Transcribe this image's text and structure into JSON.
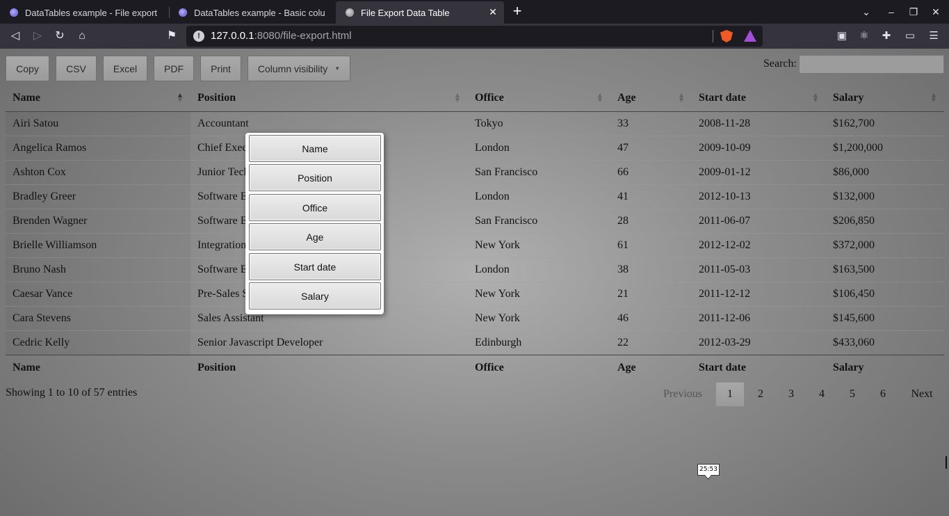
{
  "browser": {
    "tabs": [
      {
        "title": "DataTables example - File export",
        "active": false
      },
      {
        "title": "DataTables example - Basic colu",
        "active": false
      },
      {
        "title": "File Export Data Table",
        "active": true
      }
    ],
    "url_host": "127.0.0.1",
    "url_path": ":8080/file-export.html",
    "new_tab_glyph": "+",
    "close_glyph": "✕"
  },
  "toolbar": {
    "buttons": [
      "Copy",
      "CSV",
      "Excel",
      "PDF",
      "Print",
      "Column visibility"
    ],
    "search_label": "Search:",
    "search_value": ""
  },
  "table": {
    "columns": [
      "Name",
      "Position",
      "Office",
      "Age",
      "Start date",
      "Salary"
    ],
    "sorted_column": "Name",
    "sort_direction": "ascending",
    "rows": [
      [
        "Airi Satou",
        "Accountant",
        "Tokyo",
        "33",
        "2008-11-28",
        "$162,700"
      ],
      [
        "Angelica Ramos",
        "Chief Executive Officer (CEO)",
        "London",
        "47",
        "2009-10-09",
        "$1,200,000"
      ],
      [
        "Ashton Cox",
        "Junior Technical Author",
        "San Francisco",
        "66",
        "2009-01-12",
        "$86,000"
      ],
      [
        "Bradley Greer",
        "Software Engineer",
        "London",
        "41",
        "2012-10-13",
        "$132,000"
      ],
      [
        "Brenden Wagner",
        "Software Engineer",
        "San Francisco",
        "28",
        "2011-06-07",
        "$206,850"
      ],
      [
        "Brielle Williamson",
        "Integration Specialist",
        "New York",
        "61",
        "2012-12-02",
        "$372,000"
      ],
      [
        "Bruno Nash",
        "Software Engineer",
        "London",
        "38",
        "2011-05-03",
        "$163,500"
      ],
      [
        "Caesar Vance",
        "Pre-Sales Support",
        "New York",
        "21",
        "2011-12-12",
        "$106,450"
      ],
      [
        "Cara Stevens",
        "Sales Assistant",
        "New York",
        "46",
        "2011-12-06",
        "$145,600"
      ],
      [
        "Cedric Kelly",
        "Senior Javascript Developer",
        "Edinburgh",
        "22",
        "2012-03-29",
        "$433,060"
      ]
    ]
  },
  "info": "Showing 1 to 10 of 57 entries",
  "pagination": {
    "previous": "Previous",
    "pages": [
      "1",
      "2",
      "3",
      "4",
      "5",
      "6"
    ],
    "current": "1",
    "next": "Next"
  },
  "colvis_menu": [
    "Name",
    "Position",
    "Office",
    "Age",
    "Start date",
    "Salary"
  ],
  "tooltip": "25:53",
  "icons": {
    "back": "arrow-left-icon",
    "forward": "arrow-right-icon",
    "reload": "reload-icon",
    "home": "home-icon",
    "bookmark": "bookmark-icon",
    "info": "info-icon",
    "brave": "brave-shields-icon",
    "rewards": "brave-rewards-icon",
    "extensions": "puzzle-icon",
    "wallet": "wallet-icon",
    "menu": "hamburger-menu-icon"
  }
}
